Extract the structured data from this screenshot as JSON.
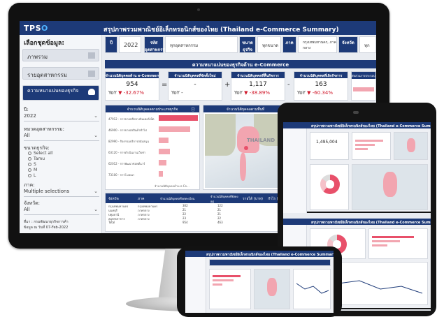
{
  "colors": {
    "header_blue": "#1d3a78",
    "accent_pink": "#f2a5b0",
    "negative_red": "#d0192b"
  },
  "app": {
    "logo": "TPS",
    "title": "สรุปภาพรวมพาณิชย์อิเล็กทรอนิกส์ของไทย (Thailand e-Commerce Summary)"
  },
  "sidebar": {
    "heading": "เลือกชุดข้อมูล:",
    "nav": [
      {
        "label": "ภาพรวม",
        "icon": "chart-icon"
      },
      {
        "label": "รายอุตสาหกรรม",
        "icon": "factory-icon"
      },
      {
        "label": "ความหนาแน่นของธุรกิจ",
        "icon": "people-icon"
      }
    ],
    "filters": {
      "year_label": "ปี:",
      "year_value": "2022",
      "industry_label": "หมวดอุตสาหกรรม:",
      "industry_value": "All",
      "size_label": "ขนาดธุรกิจ:",
      "size_options": [
        "Select all",
        "Tamu",
        "S",
        "M",
        "L"
      ],
      "region_label": "ภาค:",
      "region_value": "Multiple selections",
      "province_label": "จังหวัด:",
      "province_value": "All"
    },
    "source": "ที่มา : กรมพัฒนาธุรกิจการค้า",
    "updated": "ข้อมูล ณ วันที่ 07-Feb-2022"
  },
  "filter_bar": {
    "year_label": "ปี",
    "year_value": "2022",
    "industry_label": "รหัสอุตสาหกรรม",
    "industry_value": "ทุกอุตสาหกรรม",
    "size_label": "ขนาดธุรกิจ",
    "size_value": "ทุกขนาด",
    "region_label": "ภาค",
    "region_value": "กรุงเทพมหานคร, ภาคกลาง",
    "province_label": "จังหวัด",
    "province_value": "ทุก"
  },
  "banner": "ความหนาแน่นของธุรกิจด้าน e-Commerce",
  "kpis": [
    {
      "label": "จำนวนนิติบุคคลด้าน e-Commerce",
      "value": "954",
      "yoy_label": "YoY",
      "yoy_value": "▼ -32.67%",
      "op": "="
    },
    {
      "label": "จำนวนนิติบุคคลที่จัดตั้งใหม่",
      "value": "-",
      "yoy_label": "YoY",
      "yoy_value": "-",
      "op": "+"
    },
    {
      "label": "จำนวนนิติบุคคลที่ฟื้นกิจการ",
      "value": "1,117",
      "yoy_label": "YoY",
      "yoy_value": "▼ -38.89%",
      "op": "-"
    },
    {
      "label": "จำนวนนิติบุคคลที่เลิกกิจการ",
      "value": "163",
      "yoy_label": "YoY",
      "yoy_value": "▼ -60.34%",
      "op": ""
    }
  ],
  "extra_panel_title": "สัดส่วนการประกอบธุรกิจด้าน e-Commerce",
  "bar_panel": {
    "title": "จำนวนนิติบุคคลตามประเภทธุรกิจ",
    "axis_label": "ประเภทธุรกิจ",
    "footer": "จำนวนนิติบุคคลด้าน e-Co..."
  },
  "map_panel": {
    "title": "จำนวนนิติบุคคลตามพื้นที่",
    "country_label": "THAILAND"
  },
  "chart_data": {
    "type": "bar",
    "categories": [
      "47912 - การขายปลีกทางอินเทอร์เน็ต",
      "46900 - การขายส่งสินค้าทั่วไป",
      "82990 - กิจกรรมบริการสนับสนุน",
      "63120 - การดำเนินงานเว็บท่า",
      "62012 - การพัฒนาซอฟต์แวร์",
      "73100 - การโฆษณา"
    ],
    "values": [
      61,
      49,
      15,
      17,
      12,
      7
    ]
  },
  "table": {
    "headers": [
      "จังหวัด",
      "ภาค",
      "จำนวนนิติบุคคลที่จดทะเบียน",
      "จำนวนนิติบุคคลที่ยังคงอยู่",
      "รายได้ (บาท)",
      "กำไร (บาท)"
    ],
    "rows": [
      [
        "กรุงเทพมหานคร",
        "กรุงเทพมหานคร",
        "302",
        "122"
      ],
      [
        "นนทบุรี",
        "ภาคกลาง",
        "21",
        "21"
      ],
      [
        "ปทุมธานี",
        "ภาคกลาง",
        "22",
        "21"
      ],
      [
        "สมุทรปราการ",
        "ภาคกลาง",
        "23",
        "22"
      ],
      [
        "Total",
        "",
        "954",
        "463"
      ]
    ]
  },
  "tablet": {
    "top_title": "สรุปภาพรวมพาณิชย์อิเล็กทรอนิกส์ของไทย (Thailand e-Commerce Summary)",
    "bottom_title": "สรุปภาพรวมพาณิชย์อิเล็กทรอนิกส์ของไทย (Thailand e-Commerce Summary)",
    "kpi_value": "1,495,004"
  },
  "phone": {
    "title": "สรุปภาพรวมพาณิชย์อิเล็กทรอนิกส์ของไทย (Thailand e-Commerce Summary)"
  }
}
